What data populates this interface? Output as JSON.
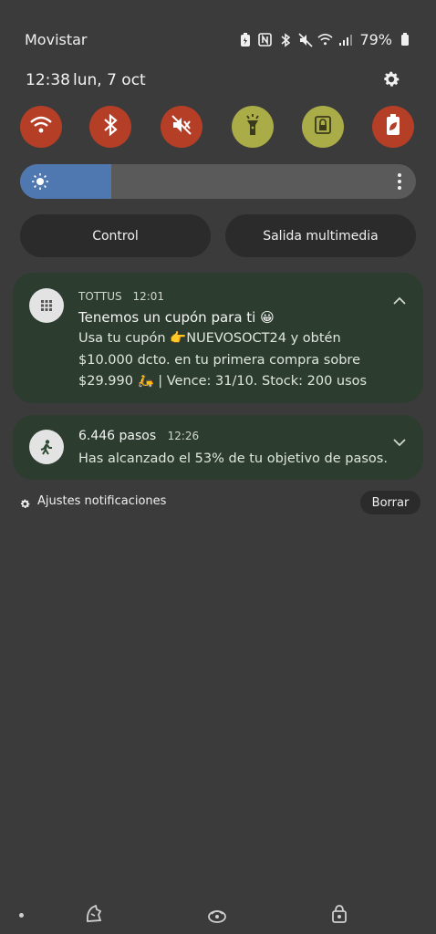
{
  "status_bar": {
    "carrier": "Movistar",
    "battery_percent": "79%",
    "icons": [
      "battery-saver-icon",
      "nfc-icon",
      "bluetooth-icon",
      "mute-icon",
      "wifi-icon",
      "signal-icon",
      "battery-icon"
    ]
  },
  "header": {
    "time": "12:38",
    "date": "lun, 7 oct"
  },
  "quick_settings": {
    "tiles": [
      {
        "name": "wifi",
        "state": "on",
        "color": "#b43e26"
      },
      {
        "name": "bluetooth",
        "state": "on",
        "color": "#b43e26"
      },
      {
        "name": "sound-mute",
        "state": "on",
        "color": "#b43e26"
      },
      {
        "name": "flashlight",
        "state": "off",
        "color": "#a9ac47"
      },
      {
        "name": "screen-lock",
        "state": "off",
        "color": "#a9ac47"
      },
      {
        "name": "power-saving",
        "state": "on",
        "color": "#b43e26"
      }
    ],
    "brightness_level": 0.23
  },
  "media": {
    "control_label": "Control",
    "output_label": "Salida multimedia"
  },
  "notifications": [
    {
      "app": "TOTTUS",
      "time": "12:01",
      "title": "Tenemos un cupón para ti 😀",
      "body": "Usa tu cupón 👉NUEVOSOCT24 y obtén $10.000 dcto. en tu primera compra sobre $29.990 🛵 | Vence: 31/10. Stock: 200 usos"
    },
    {
      "title": "6.446 pasos",
      "time": "12:26",
      "body": "Has alcanzado el 53% de tu objetivo de pasos."
    }
  ],
  "footer": {
    "settings_label": "Ajustes notificaciones",
    "clear_label": "Borrar"
  },
  "colors": {
    "background": "#3b3b3b",
    "card": "#2c3d2f",
    "accent_red": "#b43e26",
    "accent_olive": "#a9ac47",
    "brightness_fill": "#4f78b0"
  }
}
